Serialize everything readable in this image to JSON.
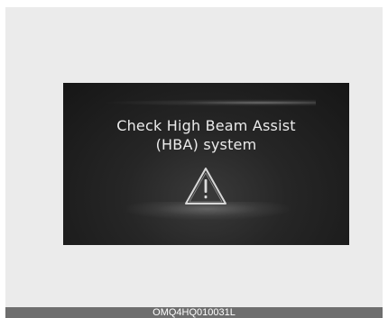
{
  "display": {
    "message_line1": "Check High Beam Assist",
    "message_line2": "(HBA) system",
    "warning_icon": "warning-triangle-icon"
  },
  "footer": {
    "code": "OMQ4HQ010031L"
  },
  "colors": {
    "background": "#ebebeb",
    "screen": "#1e1e1e",
    "text": "#ececec",
    "footer_bar": "#6e6e6e"
  }
}
